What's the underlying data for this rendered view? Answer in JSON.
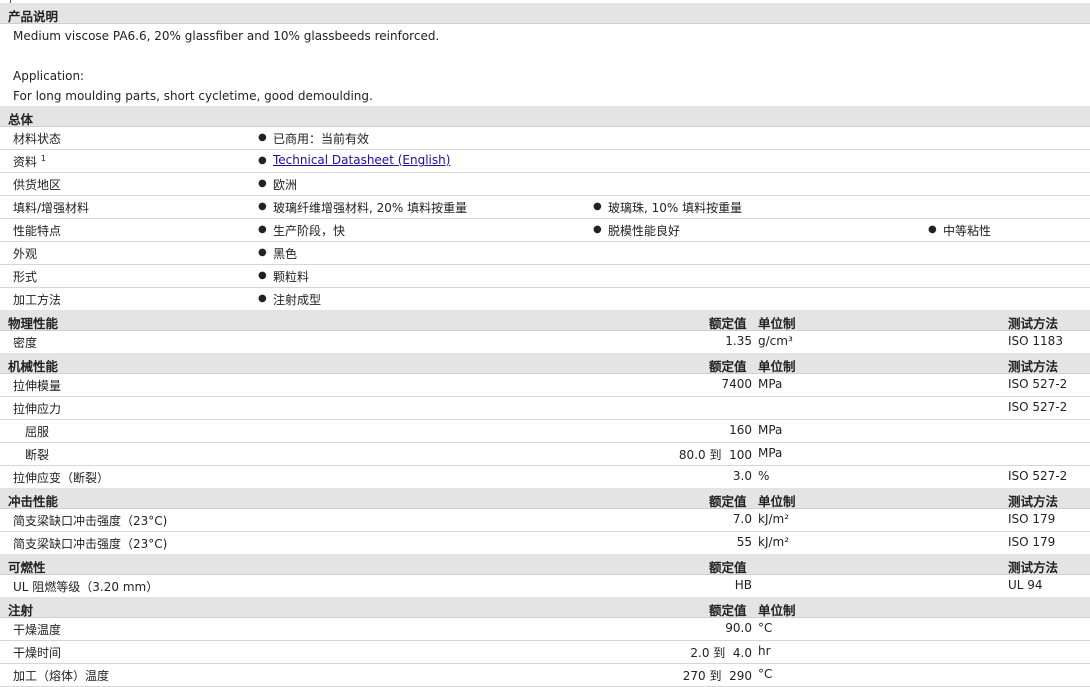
{
  "product_description": {
    "title": "产品说明",
    "line1": "Medium viscose PA6.6, 20% glassfiber and 10% glassbeeds reinforced.",
    "app_label": "Application:",
    "app_text": "For long moulding parts, short cycletime, good demoulding."
  },
  "general": {
    "title": "总体",
    "rows": [
      {
        "label": "材料状态",
        "v1": "已商用：当前有效"
      },
      {
        "label": "资料",
        "sup": "1",
        "v1": "Technical Datasheet (English)"
      },
      {
        "label": "供货地区",
        "v1": "欧洲"
      },
      {
        "label": "填料/增强材料",
        "v1": "玻璃纤维增强材料, 20% 填料按重量",
        "v2": "玻璃珠, 10% 填料按重量"
      },
      {
        "label": "性能特点",
        "v1": "生产阶段，快",
        "v2": "脱模性能良好",
        "v3": "中等粘性"
      },
      {
        "label": "外观",
        "v1": "黑色"
      },
      {
        "label": "形式",
        "v1": "颗粒料"
      },
      {
        "label": "加工方法",
        "v1": "注射成型"
      }
    ]
  },
  "headers": {
    "value": "额定值",
    "unit": "单位制",
    "method": "测试方法"
  },
  "physical": {
    "title": "物理性能",
    "rows": [
      {
        "label": "密度",
        "value": "1.35",
        "unit": "g/cm³",
        "method": "ISO 1183"
      }
    ]
  },
  "mechanical": {
    "title": "机械性能",
    "rows": [
      {
        "label": "拉伸模量",
        "value": "7400",
        "unit": "MPa",
        "method": "ISO 527-2"
      },
      {
        "label": "拉伸应力",
        "value": "",
        "unit": "",
        "method": "ISO 527-2"
      },
      {
        "label": "屈服",
        "value": "160",
        "unit": "MPa",
        "method": ""
      },
      {
        "label": "断裂",
        "value": "80.0 到  100",
        "unit": "MPa",
        "method": ""
      },
      {
        "label": "拉伸应变（断裂）",
        "value": "3.0",
        "unit": "%",
        "method": "ISO 527-2"
      }
    ]
  },
  "impact": {
    "title": "冲击性能",
    "rows": [
      {
        "label": "简支梁缺口冲击强度（23°C)",
        "value": "7.0",
        "unit": "kJ/m²",
        "method": "ISO 179"
      },
      {
        "label": "简支梁缺口冲击强度（23°C)",
        "value": "55",
        "unit": "kJ/m²",
        "method": "ISO 179"
      }
    ]
  },
  "flammability": {
    "title": "可燃性",
    "rows": [
      {
        "label": "UL 阻燃等级（3.20 mm）",
        "value": "HB",
        "unit": "",
        "method": "UL 94"
      }
    ]
  },
  "injection": {
    "title": "注射",
    "rows": [
      {
        "label": "干燥温度",
        "value": "90.0",
        "unit": "°C"
      },
      {
        "label": "干燥时间",
        "value": "2.0 到  4.0",
        "unit": "hr"
      },
      {
        "label": "加工（熔体）温度",
        "value": "270 到  290",
        "unit": "°C"
      }
    ]
  }
}
